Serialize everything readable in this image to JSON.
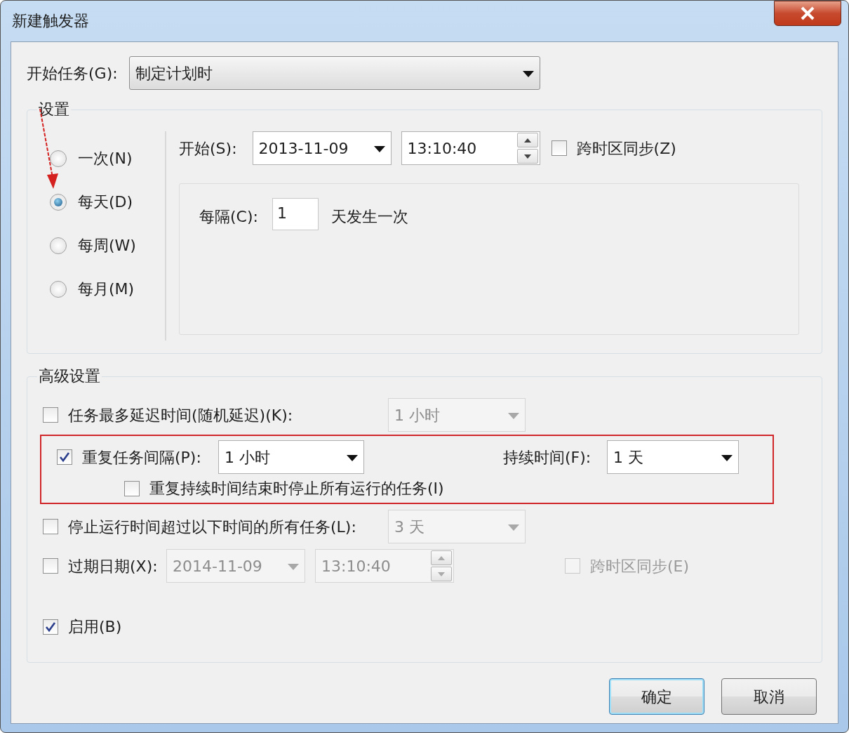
{
  "window": {
    "title": "新建触发器"
  },
  "start_task": {
    "label": "开始任务(G):",
    "value": "制定计划时"
  },
  "settings": {
    "title": "设置",
    "schedule_options": [
      {
        "label": "一次(N)",
        "selected": false
      },
      {
        "label": "每天(D)",
        "selected": true
      },
      {
        "label": "每周(W)",
        "selected": false
      },
      {
        "label": "每月(M)",
        "selected": false
      }
    ],
    "start": {
      "label": "开始(S):",
      "date": "2013-11-09",
      "time": "13:10:40",
      "sync": {
        "label": "跨时区同步(Z)",
        "checked": false
      }
    },
    "recur": {
      "label": "每隔(C):",
      "value": "1",
      "suffix": "天发生一次"
    }
  },
  "advanced": {
    "title": "高级设置",
    "delay": {
      "label": "任务最多延迟时间(随机延迟)(K):",
      "checked": false,
      "value": "1 小时",
      "disabled": true
    },
    "repeat": {
      "label": "重复任务间隔(P):",
      "checked": true,
      "value": "1 小时",
      "disabled": false,
      "duration_label": "持续时间(F):",
      "duration_value": "1 天",
      "stop_at_end": {
        "label": "重复持续时间结束时停止所有运行的任务(I)",
        "checked": false
      }
    },
    "stop_long": {
      "label": "停止运行时间超过以下时间的所有任务(L):",
      "checked": false,
      "value": "3 天",
      "disabled": true
    },
    "expire": {
      "label": "过期日期(X):",
      "checked": false,
      "date": "2014-11-09",
      "time": "13:10:40",
      "disabled": true,
      "sync": {
        "label": "跨时区同步(E)",
        "checked": false,
        "disabled": true
      }
    },
    "enabled": {
      "label": "启用(B)",
      "checked": true
    }
  },
  "buttons": [
    {
      "label": "确定",
      "default": true
    },
    {
      "label": "取消",
      "default": false
    }
  ]
}
